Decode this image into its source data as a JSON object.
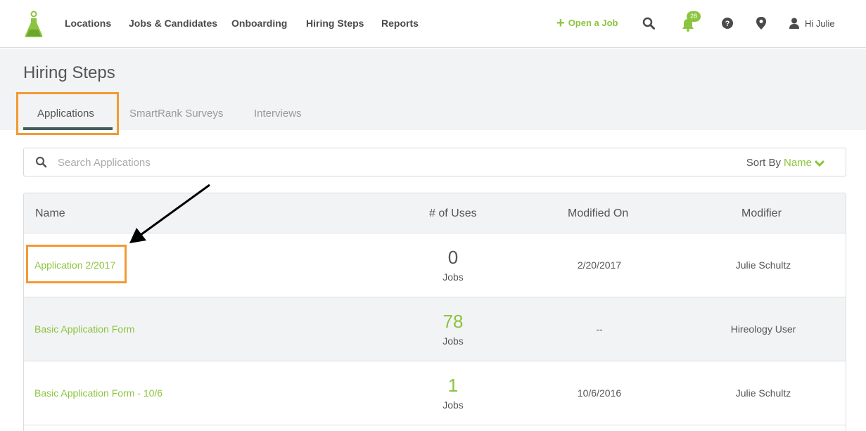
{
  "nav": {
    "items": [
      "Locations",
      "Jobs & Candidates",
      "Onboarding",
      "Hiring Steps",
      "Reports"
    ],
    "open_job_label": "Open a Job",
    "notification_count": "28",
    "user_greeting": "Hi Julie",
    "icons": [
      "search-icon",
      "bell-icon",
      "help-icon",
      "location-pin-icon",
      "user-icon"
    ]
  },
  "page": {
    "title": "Hiring Steps",
    "tabs": [
      "Applications",
      "SmartRank Surveys",
      "Interviews"
    ],
    "active_tab": "Applications"
  },
  "search": {
    "placeholder": "Search Applications",
    "sort_label": "Sort By",
    "sort_value": "Name"
  },
  "table": {
    "columns": [
      "Name",
      "# of Uses",
      "Modified On",
      "Modifier"
    ],
    "rows": [
      {
        "name": "Application 2/2017",
        "uses": "0",
        "unit": "Jobs",
        "modified": "2/20/2017",
        "modifier": "Julie Schultz"
      },
      {
        "name": "Basic Application Form",
        "uses": "78",
        "unit": "Jobs",
        "modified": "--",
        "modifier": "Hireology User"
      },
      {
        "name": "Basic Application Form - 10/6",
        "uses": "1",
        "unit": "Jobs",
        "modified": "10/6/2016",
        "modifier": "Julie Schultz"
      }
    ]
  },
  "colors": {
    "accent": "#8cc43f",
    "highlight": "#f29a32",
    "tab_underline": "#3f5f5f",
    "band": "#f2f3f4"
  }
}
